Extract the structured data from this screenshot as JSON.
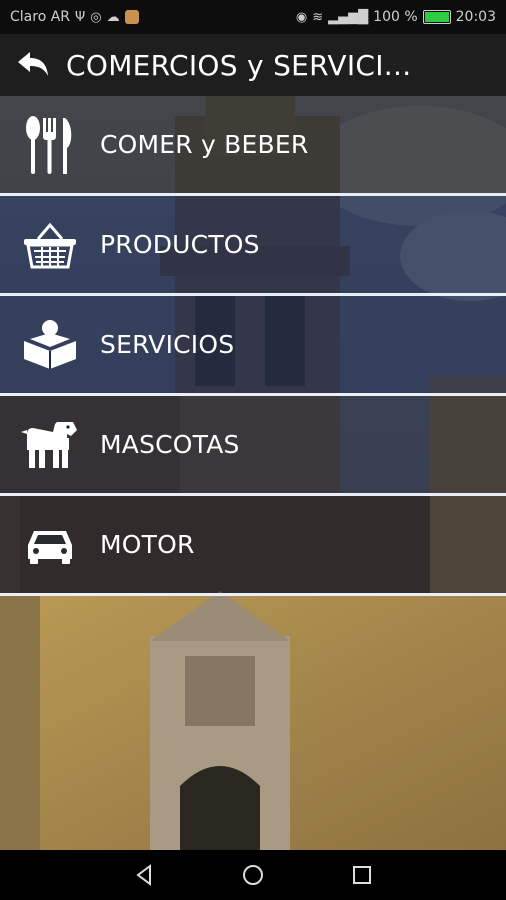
{
  "status_bar": {
    "carrier": "Claro AR",
    "battery": "100 %",
    "time": "20:03"
  },
  "header": {
    "title": "COMERCIOS y SERVICI..."
  },
  "menu": [
    {
      "label": "COMER y BEBER",
      "icon": "cutlery-icon"
    },
    {
      "label": "PRODUCTOS",
      "icon": "basket-icon"
    },
    {
      "label": "SERVICIOS",
      "icon": "reader-icon"
    },
    {
      "label": "MASCOTAS",
      "icon": "dog-icon"
    },
    {
      "label": "MOTOR",
      "icon": "car-icon"
    }
  ],
  "colors": {
    "header_bg": "#1e1e1e",
    "row_overlay": "#1c2a4a",
    "divider": "#e9eef7"
  }
}
